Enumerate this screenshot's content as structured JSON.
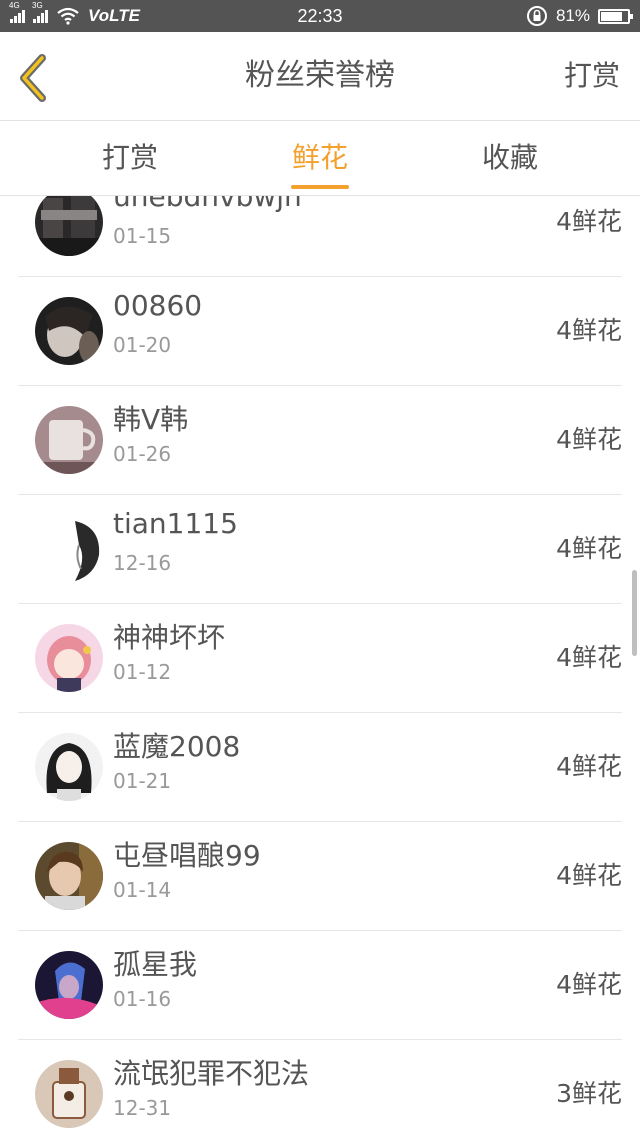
{
  "status_bar": {
    "net1": "4G",
    "net2": "3G",
    "volte": "VoLTE",
    "time": "22:33",
    "battery_text": "81%",
    "battery_level": 0.81
  },
  "header": {
    "title": "粉丝荣誉榜",
    "action": "打赏"
  },
  "tabs": [
    {
      "label": "打赏",
      "active": false
    },
    {
      "label": "鲜花",
      "active": true
    },
    {
      "label": "收藏",
      "active": false
    }
  ],
  "colors": {
    "accent": "#f3a02e",
    "status_bar": "#545454"
  },
  "list": [
    {
      "name": "unebdhvbwjh",
      "date": "01-15",
      "amount": "4鲜花",
      "avatar": "dark-photo"
    },
    {
      "name": "00860",
      "date": "01-20",
      "amount": "4鲜花",
      "avatar": "girl-photo"
    },
    {
      "name": "韩V韩",
      "date": "01-26",
      "amount": "4鲜花",
      "avatar": "coffee-cup"
    },
    {
      "name": "tian1115",
      "date": "12-16",
      "amount": "4鲜花",
      "avatar": "sketch-profile"
    },
    {
      "name": "神神坏坏",
      "date": "01-12",
      "amount": "4鲜花",
      "avatar": "anime-pink"
    },
    {
      "name": "蓝魔2008",
      "date": "01-21",
      "amount": "4鲜花",
      "avatar": "anime-dark-hair"
    },
    {
      "name": "屯昼唱酿99",
      "date": "01-14",
      "amount": "4鲜花",
      "avatar": "boy-photo"
    },
    {
      "name": "孤星我",
      "date": "01-16",
      "amount": "4鲜花",
      "avatar": "game-character"
    },
    {
      "name": "流氓犯罪不犯法",
      "date": "12-31",
      "amount": "3鲜花",
      "avatar": "cafe-cup"
    }
  ]
}
